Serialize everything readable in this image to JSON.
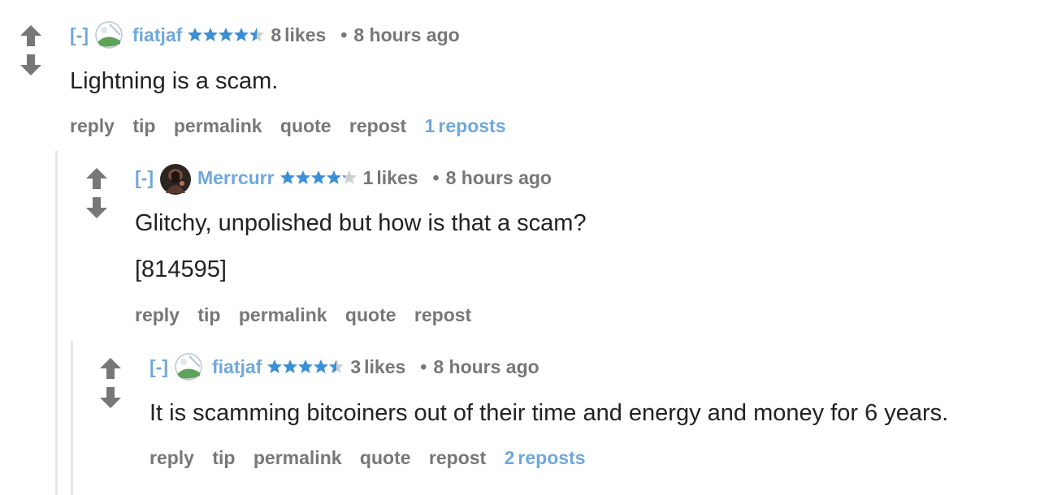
{
  "icons": {
    "upvote": "up-arrow-icon",
    "downvote": "down-arrow-icon",
    "star": "star-icon",
    "avatar_placeholder": "image-placeholder-icon"
  },
  "colors": {
    "link": "#6fa8dc",
    "muted": "#777777",
    "star": "#3b8fd6",
    "star_empty": "#cfcfcf",
    "thread_line": "#e6e6e6"
  },
  "comments": [
    {
      "toggle": "[-]",
      "avatar": "image-placeholder-icon",
      "username": "fiatjaf",
      "rating": 4.5,
      "likes_count": "8",
      "likes_label": "likes",
      "dot": "•",
      "time": "8 hours ago",
      "lines": [
        "Lightning is a scam."
      ],
      "actions": [
        "reply",
        "tip",
        "permalink",
        "quote",
        "repost"
      ],
      "reposts_count": "1",
      "reposts_label": "reposts"
    },
    {
      "toggle": "[-]",
      "avatar": "user-photo",
      "username": "Merrcurr",
      "rating": 4.2,
      "likes_count": "1",
      "likes_label": "likes",
      "dot": "•",
      "time": "8 hours ago",
      "lines": [
        "Glitchy, unpolished but how is that a scam?",
        "[814595]"
      ],
      "actions": [
        "reply",
        "tip",
        "permalink",
        "quote",
        "repost"
      ]
    },
    {
      "toggle": "[-]",
      "avatar": "image-placeholder-icon",
      "username": "fiatjaf",
      "rating": 4.5,
      "likes_count": "3",
      "likes_label": "likes",
      "dot": "•",
      "time": "8 hours ago",
      "lines": [
        "It is scamming bitcoiners out of their time and energy and money for 6 years."
      ],
      "actions": [
        "reply",
        "tip",
        "permalink",
        "quote",
        "repost"
      ],
      "reposts_count": "2",
      "reposts_label": "reposts"
    }
  ]
}
